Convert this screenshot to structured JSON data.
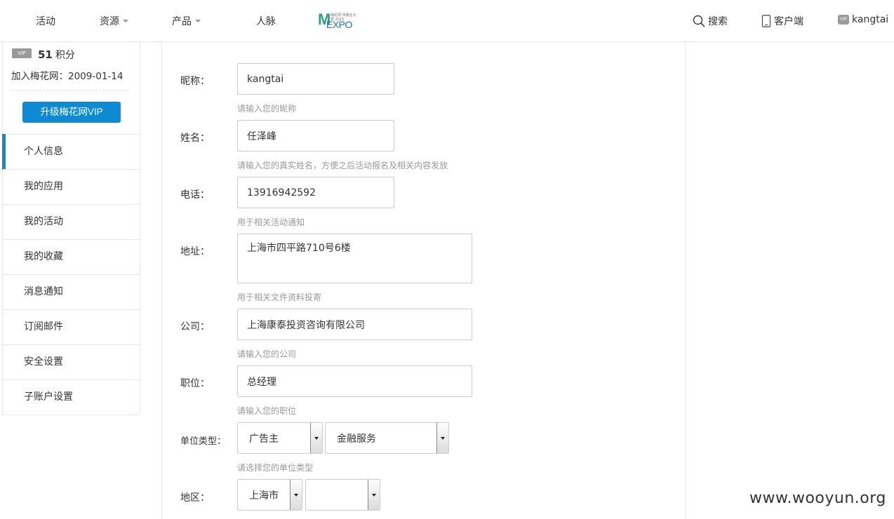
{
  "nav": {
    "items": [
      "活动",
      "资源",
      "产品",
      "人脉"
    ],
    "logo": {
      "mark": "M",
      "text": "EXPO",
      "tiny": "梅花网 传播业大展 2015"
    },
    "search": "搜索",
    "client": "客户端",
    "user": "kangtai",
    "vip_badge": "VIP"
  },
  "sidebar": {
    "vip_tag": "VIP",
    "points_value": "51",
    "points_label": "积分",
    "join_date": "加入梅花网：2009-01-14",
    "upgrade_button": "升级梅花网VIP",
    "menu": [
      "个人信息",
      "我的应用",
      "我的活动",
      "我的收藏",
      "消息通知",
      "订阅邮件",
      "安全设置",
      "子账户设置"
    ],
    "active_index": 0
  },
  "form": {
    "nickname": {
      "label": "昵称：",
      "value": "kangtai",
      "hint": "请输入您的昵称"
    },
    "name": {
      "label": "姓名：",
      "value": "任泽峰",
      "hint": "请输入您的真实姓名，方便之后活动报名及相关内容发放"
    },
    "phone": {
      "label": "电话：",
      "value": "13916942592",
      "hint": "用于相关活动通知"
    },
    "address": {
      "label": "地址：",
      "value": "上海市四平路710号6楼",
      "hint": "用于相关文件资料投寄"
    },
    "company": {
      "label": "公司：",
      "value": "上海康泰投资咨询有限公司",
      "hint": "请输入您的公司"
    },
    "position": {
      "label": "职位：",
      "value": "总经理",
      "hint": "请输入您的职位"
    },
    "unit_type": {
      "label": "单位类型：",
      "primary": "广告主",
      "secondary": "金融服务",
      "hint": "请选择您的单位类型"
    },
    "region": {
      "label": "地区：",
      "province": "上海市",
      "city": ""
    }
  },
  "watermark": "www.wooyun.org"
}
